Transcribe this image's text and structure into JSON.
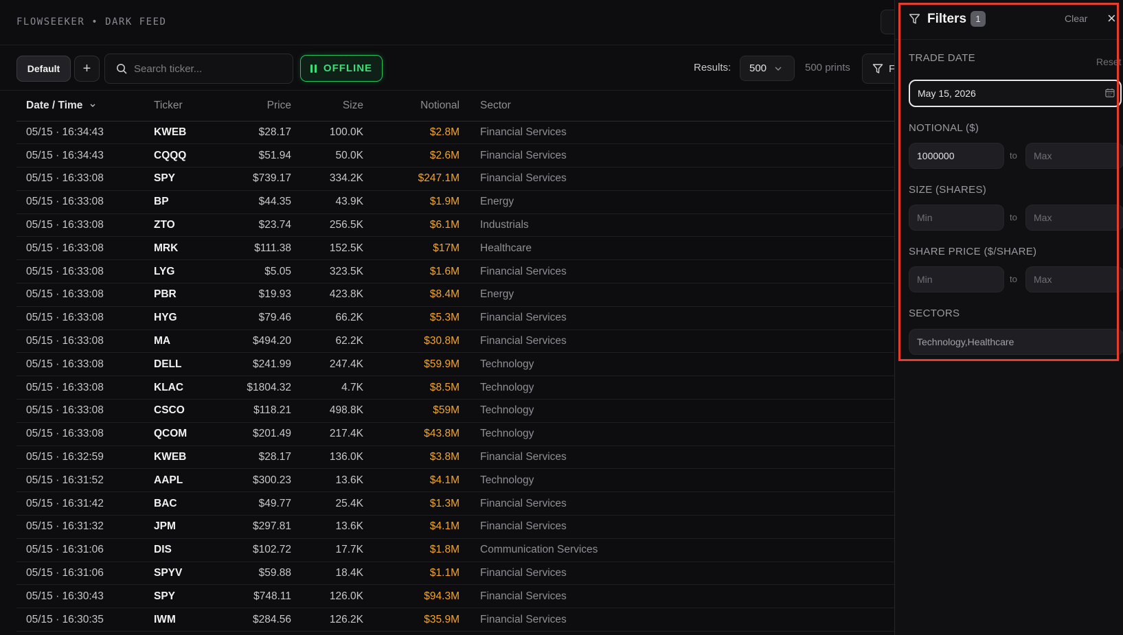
{
  "header": {
    "brand": "FLOWSEEKER • DARK FEED"
  },
  "toolbar": {
    "preset_label": "Default",
    "add_label": "+",
    "search_placeholder": "Search ticker...",
    "live_status": "OFFLINE",
    "results_label": "Results:",
    "results_value": "500",
    "prints_count": "500 prints",
    "filter_button_label": "F"
  },
  "table": {
    "columns": [
      "Date / Time",
      "Ticker",
      "Price",
      "Size",
      "Notional",
      "Sector"
    ],
    "rows": [
      [
        "05/15 · 16:34:43",
        "KWEB",
        "$28.17",
        "100.0K",
        "$2.8M",
        "Financial Services"
      ],
      [
        "05/15 · 16:34:43",
        "CQQQ",
        "$51.94",
        "50.0K",
        "$2.6M",
        "Financial Services"
      ],
      [
        "05/15 · 16:33:08",
        "SPY",
        "$739.17",
        "334.2K",
        "$247.1M",
        "Financial Services"
      ],
      [
        "05/15 · 16:33:08",
        "BP",
        "$44.35",
        "43.9K",
        "$1.9M",
        "Energy"
      ],
      [
        "05/15 · 16:33:08",
        "ZTO",
        "$23.74",
        "256.5K",
        "$6.1M",
        "Industrials"
      ],
      [
        "05/15 · 16:33:08",
        "MRK",
        "$111.38",
        "152.5K",
        "$17M",
        "Healthcare"
      ],
      [
        "05/15 · 16:33:08",
        "LYG",
        "$5.05",
        "323.5K",
        "$1.6M",
        "Financial Services"
      ],
      [
        "05/15 · 16:33:08",
        "PBR",
        "$19.93",
        "423.8K",
        "$8.4M",
        "Energy"
      ],
      [
        "05/15 · 16:33:08",
        "HYG",
        "$79.46",
        "66.2K",
        "$5.3M",
        "Financial Services"
      ],
      [
        "05/15 · 16:33:08",
        "MA",
        "$494.20",
        "62.2K",
        "$30.8M",
        "Financial Services"
      ],
      [
        "05/15 · 16:33:08",
        "DELL",
        "$241.99",
        "247.4K",
        "$59.9M",
        "Technology"
      ],
      [
        "05/15 · 16:33:08",
        "KLAC",
        "$1804.32",
        "4.7K",
        "$8.5M",
        "Technology"
      ],
      [
        "05/15 · 16:33:08",
        "CSCO",
        "$118.21",
        "498.8K",
        "$59M",
        "Technology"
      ],
      [
        "05/15 · 16:33:08",
        "QCOM",
        "$201.49",
        "217.4K",
        "$43.8M",
        "Technology"
      ],
      [
        "05/15 · 16:32:59",
        "KWEB",
        "$28.17",
        "136.0K",
        "$3.8M",
        "Financial Services"
      ],
      [
        "05/15 · 16:31:52",
        "AAPL",
        "$300.23",
        "13.6K",
        "$4.1M",
        "Technology"
      ],
      [
        "05/15 · 16:31:42",
        "BAC",
        "$49.77",
        "25.4K",
        "$1.3M",
        "Financial Services"
      ],
      [
        "05/15 · 16:31:32",
        "JPM",
        "$297.81",
        "13.6K",
        "$4.1M",
        "Financial Services"
      ],
      [
        "05/15 · 16:31:06",
        "DIS",
        "$102.72",
        "17.7K",
        "$1.8M",
        "Communication Services"
      ],
      [
        "05/15 · 16:31:06",
        "SPYV",
        "$59.88",
        "18.4K",
        "$1.1M",
        "Financial Services"
      ],
      [
        "05/15 · 16:30:43",
        "SPY",
        "$748.11",
        "126.0K",
        "$94.3M",
        "Financial Services"
      ],
      [
        "05/15 · 16:30:35",
        "IWM",
        "$284.56",
        "126.2K",
        "$35.9M",
        "Financial Services"
      ]
    ]
  },
  "filters": {
    "title": "Filters",
    "active_count": "1",
    "clear_label": "Clear",
    "close_label": "×",
    "trade_date": {
      "label": "TRADE DATE",
      "reset_label": "Reset",
      "value": "May 15, 2026"
    },
    "notional": {
      "label": "NOTIONAL ($)",
      "min_value": "1000000",
      "max_placeholder": "Max",
      "to": "to"
    },
    "size": {
      "label": "SIZE (SHARES)",
      "min_placeholder": "Min",
      "max_placeholder": "Max",
      "to": "to"
    },
    "price": {
      "label": "SHARE PRICE ($/SHARE)",
      "min_placeholder": "Min",
      "max_placeholder": "Max",
      "to": "to"
    },
    "sectors": {
      "label": "SECTORS",
      "value": "Technology,Healthcare"
    }
  },
  "colors": {
    "accent_live": "#22c55e",
    "notional": "#f5a524",
    "highlight": "#e53e2e"
  }
}
